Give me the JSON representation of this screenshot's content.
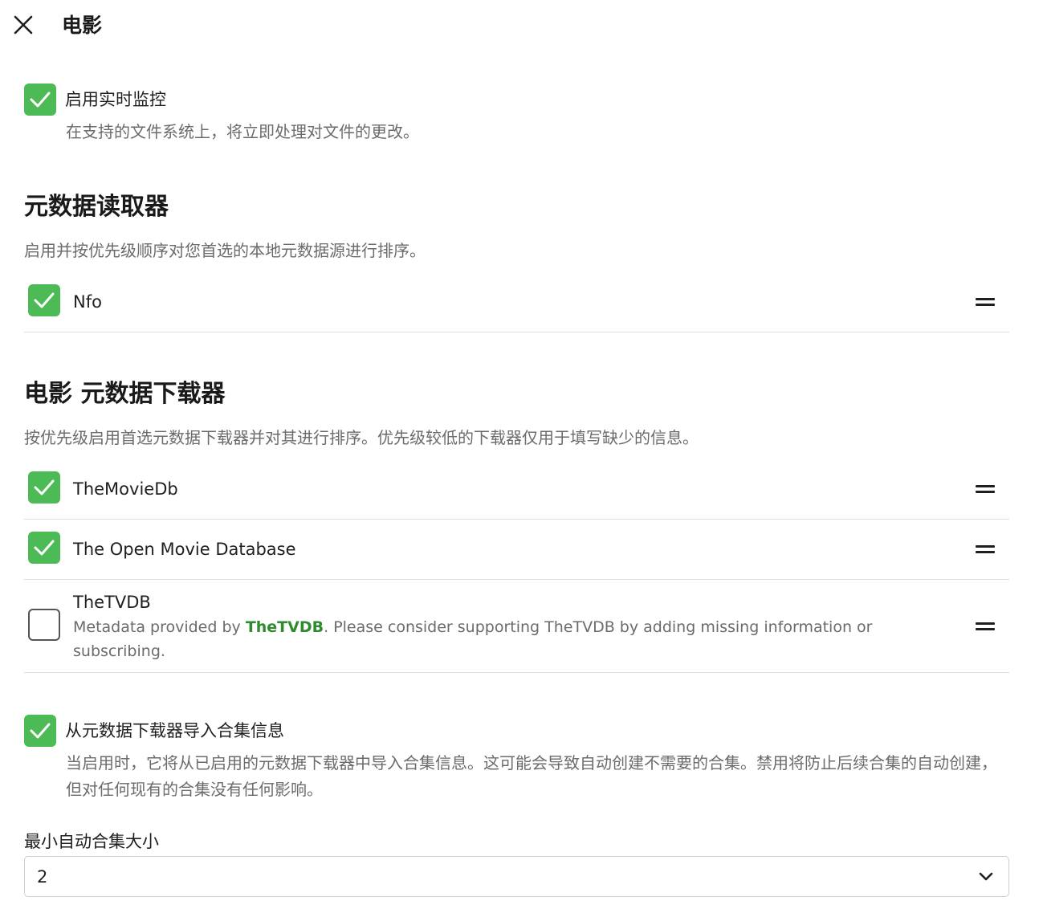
{
  "header": {
    "title": "电影"
  },
  "realtime_monitor": {
    "label": "启用实时监控",
    "description": "在支持的文件系统上，将立即处理对文件的更改。",
    "checked": true
  },
  "metadata_readers": {
    "title": "元数据读取器",
    "description": "启用并按优先级顺序对您首选的本地元数据源进行排序。",
    "items": [
      {
        "label": "Nfo",
        "checked": true
      }
    ]
  },
  "metadata_downloaders": {
    "title": "电影 元数据下载器",
    "description": "按优先级启用首选元数据下载器并对其进行排序。优先级较低的下载器仅用于填写缺少的信息。",
    "items": [
      {
        "label": "TheMovieDb",
        "checked": true
      },
      {
        "label": "The Open Movie Database",
        "checked": true
      },
      {
        "label": "TheTVDB",
        "checked": false,
        "desc_prefix": "Metadata provided by ",
        "desc_link": "TheTVDB",
        "desc_suffix": ". Please consider supporting TheTVDB by adding missing information or subscribing."
      }
    ]
  },
  "import_collections": {
    "label": "从元数据下载器导入合集信息",
    "description": "当启用时，它将从已启用的元数据下载器中导入合集信息。这可能会导致自动创建不需要的合集。禁用将防止后续合集的自动创建，但对任何现有的合集没有任何影响。",
    "checked": true
  },
  "min_collection_size": {
    "label": "最小自动合集大小",
    "value": "2"
  },
  "colors": {
    "checkbox_checked": "#4cbb55",
    "link": "#2e8b2e",
    "muted_text": "#6b6b6b"
  },
  "icons": {
    "close": "close-icon",
    "check": "checkmark-icon",
    "drag": "drag-handle-icon",
    "chevron": "chevron-down-icon"
  }
}
